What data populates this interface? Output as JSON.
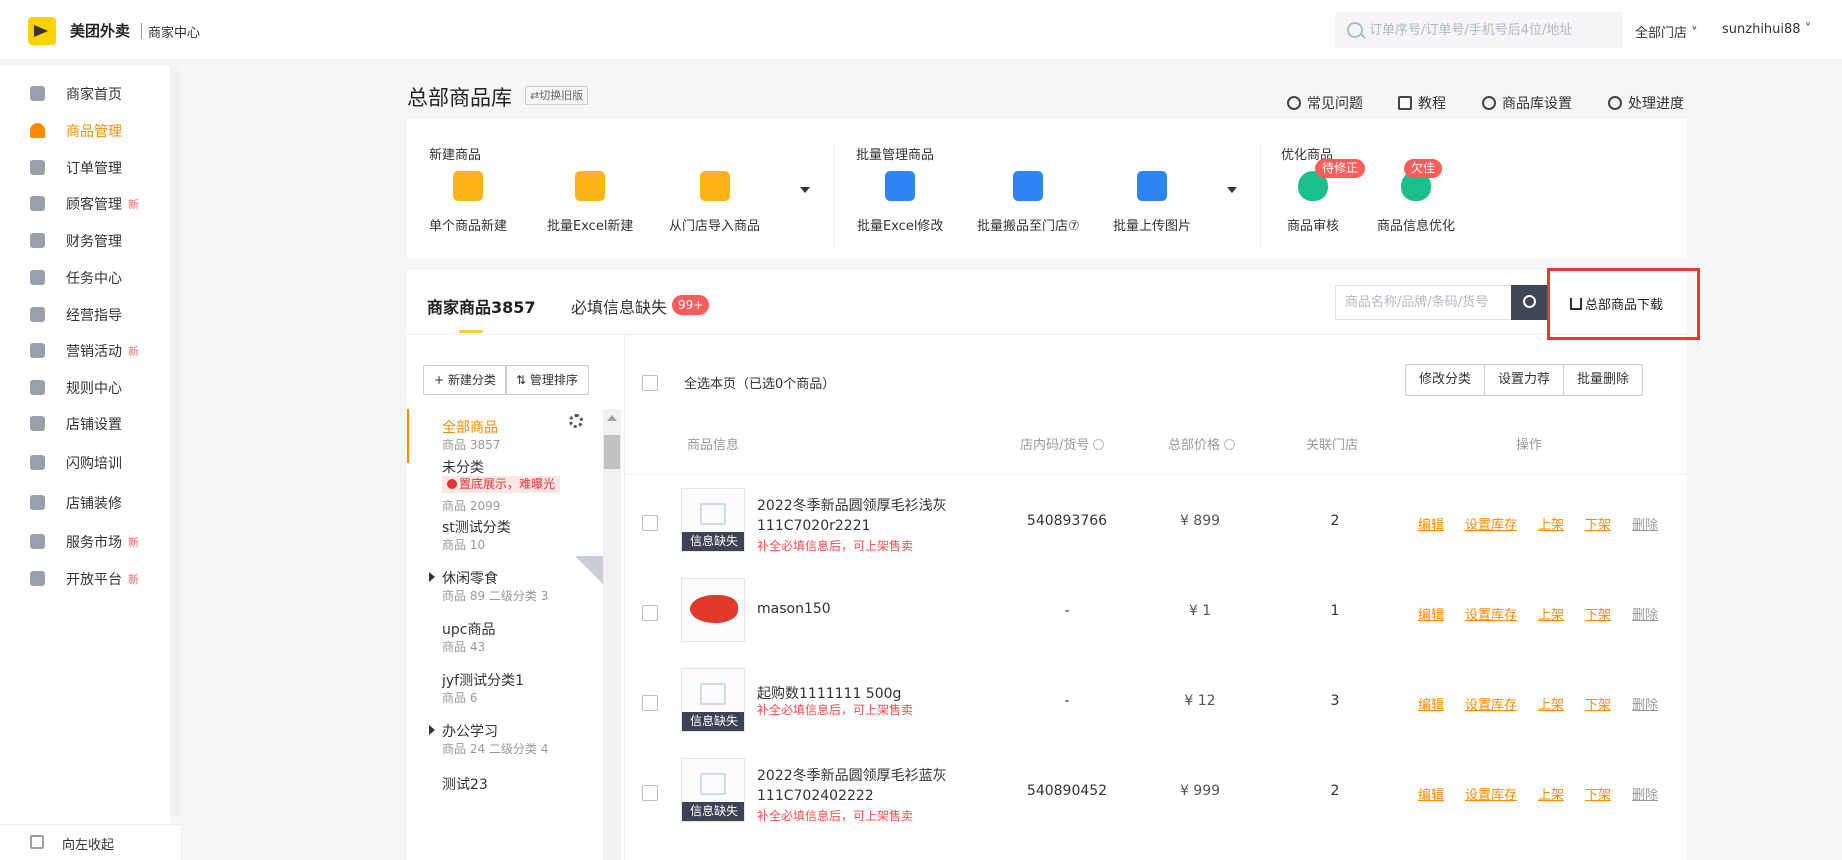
{
  "header": {
    "brand": "美团外卖",
    "brand_sub": "商家中心",
    "search_placeholder": "订单序号/订单号/手机号后4位/地址",
    "store_select": "全部门店",
    "username": "sunzhihui88"
  },
  "sidebar": {
    "items": [
      {
        "label": "商家首页",
        "badge": ""
      },
      {
        "label": "商品管理",
        "badge": "",
        "active": true
      },
      {
        "label": "订单管理",
        "badge": ""
      },
      {
        "label": "顾客管理",
        "badge": "新"
      },
      {
        "label": "财务管理",
        "badge": ""
      },
      {
        "label": "任务中心",
        "badge": ""
      },
      {
        "label": "经营指导",
        "badge": ""
      },
      {
        "label": "营销活动",
        "badge": "新"
      },
      {
        "label": "规则中心",
        "badge": ""
      },
      {
        "label": "店铺设置",
        "badge": ""
      },
      {
        "label": "闪购培训",
        "badge": ""
      },
      {
        "label": "店铺装修",
        "badge": ""
      },
      {
        "label": "服务市场",
        "badge": "新"
      },
      {
        "label": "开放平台",
        "badge": "新"
      }
    ],
    "collapse_label": "向左收起"
  },
  "page": {
    "title": "总部商品库",
    "switch_old": "⇄切换旧版",
    "links": [
      "常见问题",
      "教程",
      "商品库设置",
      "处理进度"
    ]
  },
  "tools": {
    "groups": [
      "新建商品",
      "批量管理商品",
      "优化商品"
    ],
    "items": [
      {
        "label": "单个商品新建",
        "color": "#ffb31a"
      },
      {
        "label": "批量Excel新建",
        "color": "#ffb31a"
      },
      {
        "label": "从门店导入商品",
        "color": "#ffb31a"
      },
      {
        "label": "批量Excel修改",
        "color": "#2e86f5"
      },
      {
        "label": "批量搬品至门店⑦",
        "color": "#2e86f5"
      },
      {
        "label": "批量上传图片",
        "color": "#2e86f5"
      },
      {
        "label": "商品审核",
        "color": "#19c08b",
        "badge": "待修正"
      },
      {
        "label": "商品信息优化",
        "color": "#19c08b",
        "badge": "欠佳"
      }
    ]
  },
  "list": {
    "tab_products": "商家商品3857",
    "tab_missing": "必填信息缺失",
    "tab_missing_badge": "99+",
    "search_placeholder": "商品名称/品牌/条码/货号",
    "download_label": "总部商品下载",
    "btn_new_category": "+ 新建分类",
    "btn_sort": "⇅ 管理排序",
    "select_all": "全选本页（已选0个商品）",
    "bulk_actions": [
      "修改分类",
      "设置力荐",
      "批量删除"
    ],
    "columns": [
      "商品信息",
      "店内码/货号",
      "总部价格",
      "关联门店",
      "操作"
    ],
    "categories": [
      {
        "name": "全部商品",
        "meta": "商品 3857",
        "active": true
      },
      {
        "name": "未分类",
        "warn": "置底展示，难曝光",
        "meta": "商品 2099"
      },
      {
        "name": "st测试分类",
        "meta": "商品 10"
      },
      {
        "name": "休闲零食",
        "meta": "商品 89 二级分类 3",
        "expandable": true
      },
      {
        "name": "upc商品",
        "meta": "商品 43"
      },
      {
        "name": "jyf测试分类1",
        "meta": "商品 6"
      },
      {
        "name": "办公学习",
        "meta": "商品 24 二级分类 4",
        "expandable": true
      },
      {
        "name": "测试23",
        "meta": ""
      }
    ],
    "ops": [
      "编辑",
      "设置库存",
      "上架",
      "下架",
      "删除"
    ],
    "rows": [
      {
        "name": "2022冬季新品圆领厚毛衫浅灰111C7020r2221",
        "note": "补全必填信息后，可上架售卖",
        "code": "540893766",
        "price": "¥ 899",
        "stores": "2",
        "missing": "信息缺失"
      },
      {
        "name": "mason150",
        "note": "",
        "code": "-",
        "price": "¥ 1",
        "stores": "1",
        "missing": ""
      },
      {
        "name": "起购数1111111 500g",
        "note": "补全必填信息后，可上架售卖",
        "code": "-",
        "price": "¥ 12",
        "stores": "3",
        "missing": "信息缺失"
      },
      {
        "name": "2022冬季新品圆领厚毛衫蓝灰111C702402222",
        "note": "补全必填信息后，可上架售卖",
        "code": "540890452",
        "price": "¥ 999",
        "stores": "2",
        "missing": "信息缺失"
      }
    ]
  }
}
